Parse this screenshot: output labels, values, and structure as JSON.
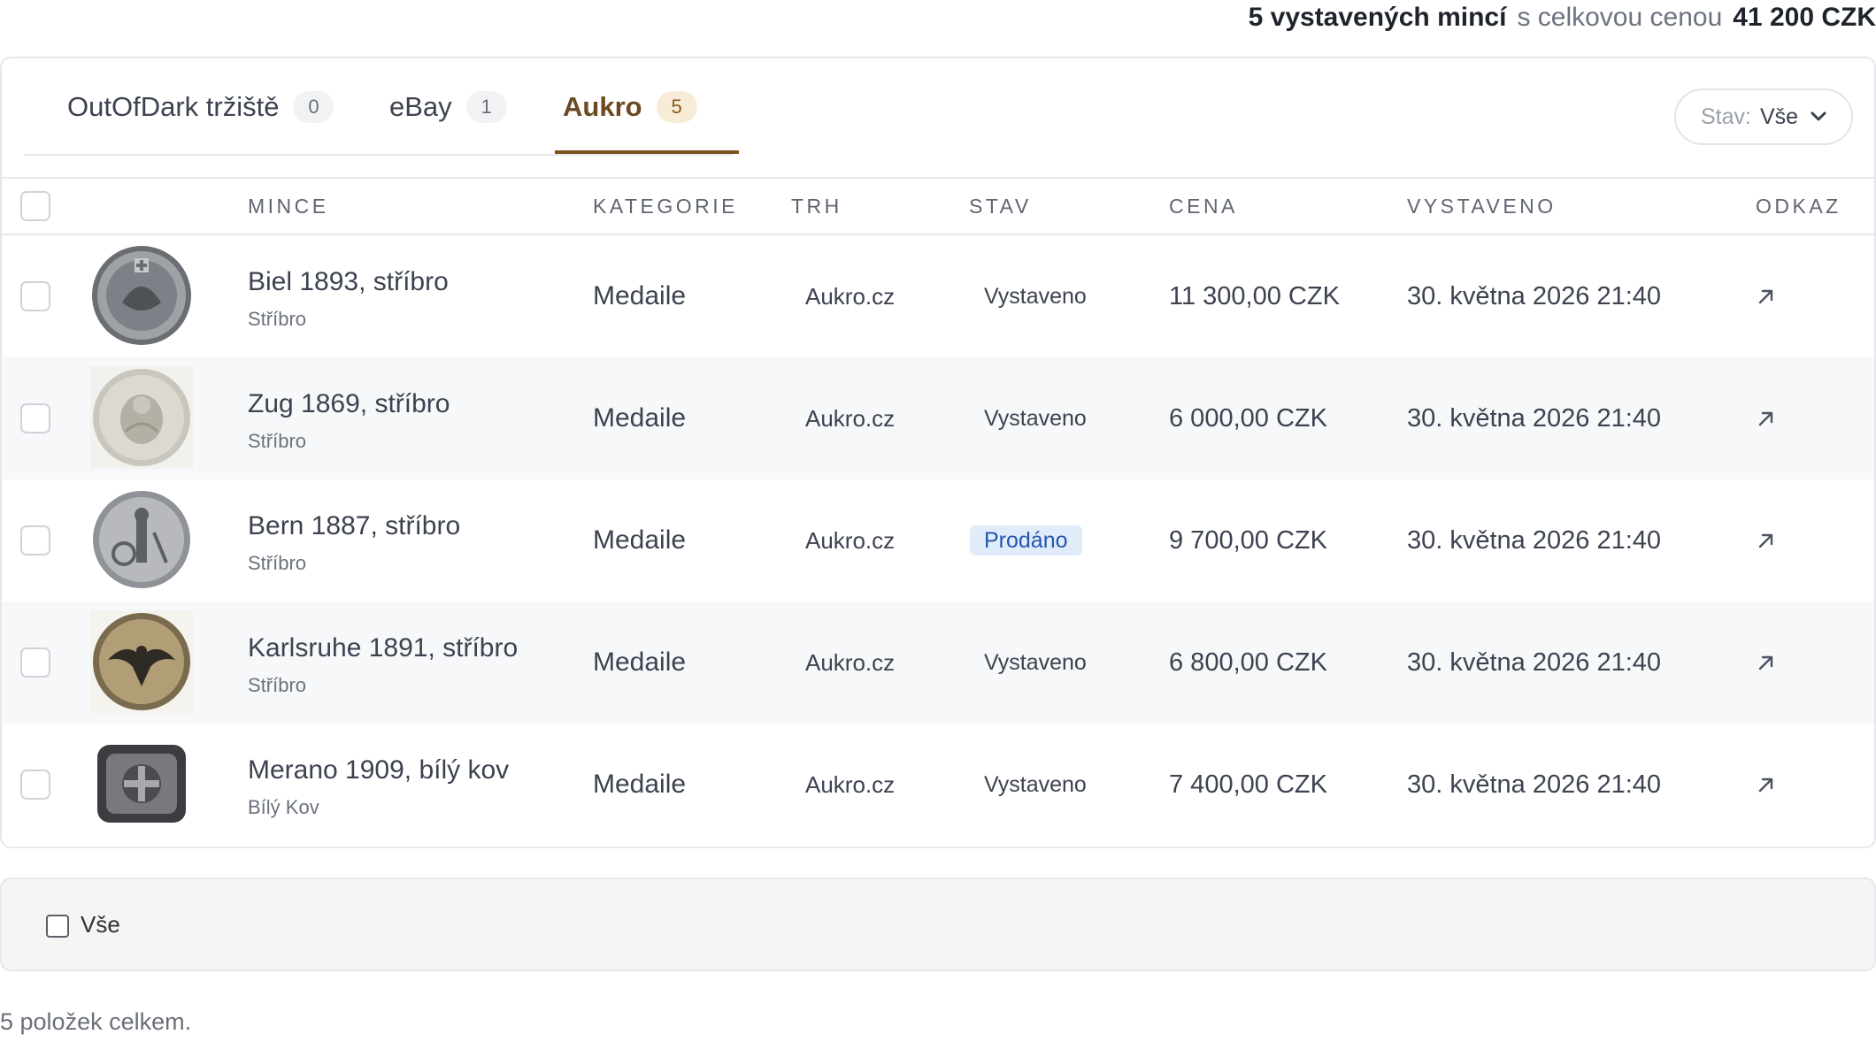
{
  "summary": {
    "count_label": "5 vystavených mincí",
    "middle": "s celkovou cenou",
    "total_price": "41 200 CZK"
  },
  "tabs": [
    {
      "label": "OutOfDark tržiště",
      "count": "0",
      "active": false
    },
    {
      "label": "eBay",
      "count": "1",
      "active": false
    },
    {
      "label": "Aukro",
      "count": "5",
      "active": true
    }
  ],
  "filter": {
    "label": "Stav:",
    "value": "Vše",
    "icon": "chevron-down-icon"
  },
  "columns": {
    "coin": "MINCE",
    "category": "KATEGORIE",
    "market": "TRH",
    "status": "STAV",
    "price": "CENA",
    "listed": "VYSTAVENO",
    "link": "ODKAZ"
  },
  "rows": [
    {
      "name": "Biel 1893, stříbro",
      "metal": "Stříbro",
      "category": "Medaile",
      "market": "Aukro.cz",
      "status": "Vystaveno",
      "price": "11 300,00 CZK",
      "listed": "30. května 2026 21:40"
    },
    {
      "name": "Zug 1869, stříbro",
      "metal": "Stříbro",
      "category": "Medaile",
      "market": "Aukro.cz",
      "status": "Vystaveno",
      "price": "6 000,00 CZK",
      "listed": "30. května 2026 21:40"
    },
    {
      "name": "Bern 1887, stříbro",
      "metal": "Stříbro",
      "category": "Medaile",
      "market": "Aukro.cz",
      "status": "Prodáno",
      "price": "9 700,00 CZK",
      "listed": "30. května 2026 21:40"
    },
    {
      "name": "Karlsruhe 1891, stříbro",
      "metal": "Stříbro",
      "category": "Medaile",
      "market": "Aukro.cz",
      "status": "Vystaveno",
      "price": "6 800,00 CZK",
      "listed": "30. května 2026 21:40"
    },
    {
      "name": "Merano 1909, bílý kov",
      "metal": "Bílý Kov",
      "category": "Medaile",
      "market": "Aukro.cz",
      "status": "Vystaveno",
      "price": "7 400,00 CZK",
      "listed": "30. května 2026 21:40"
    }
  ],
  "footer": {
    "select_all_label": "Vše"
  },
  "total_items": "5 položek celkem.",
  "colors": {
    "accent": "#7a5222",
    "sold_badge_bg": "#e1ecfb",
    "sold_badge_text": "#2356b0",
    "row_alt": "#f7f8fa"
  }
}
